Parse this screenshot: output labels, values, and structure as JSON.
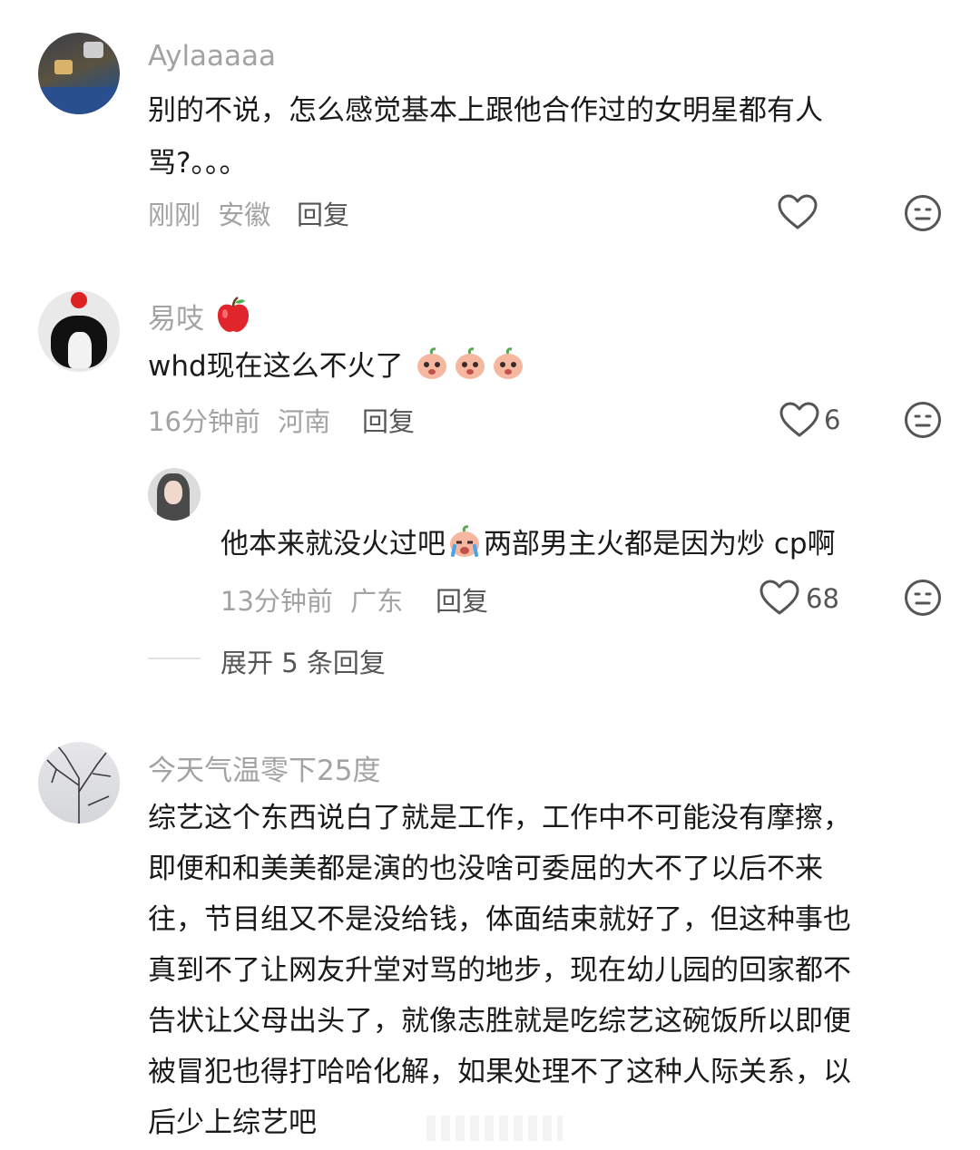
{
  "comments": [
    {
      "user": "Aylaaaaa",
      "text_line1": "别的不说，怎么感觉基本上跟他合作过的女明星都有人",
      "text_line2": "骂?。。。",
      "time": "刚刚",
      "location": "安徽",
      "reply_label": "回复",
      "like_count": ""
    },
    {
      "user": "易吱",
      "user_emoji": "red-apple-icon",
      "text": "whd现在这么不火了",
      "time": "16分钟前",
      "location": "河南",
      "reply_label": "回复",
      "like_count": "6",
      "sub_reply": {
        "text_before": "他本来就没火过吧",
        "text_after": "两部男主火都是因为炒 cp啊",
        "time": "13分钟前",
        "location": "广东",
        "reply_label": "回复",
        "like_count": "68"
      },
      "expand_label": "展开 5 条回复"
    },
    {
      "user": "今天气温零下25度",
      "lines": [
        "综艺这个东西说白了就是工作，工作中不可能没有摩擦，",
        "即便和和美美都是演的也没啥可委屈的大不了以后不来",
        "往，节目组又不是没给钱，体面结束就好了，但这种事也",
        "真到不了让网友升堂对骂的地步，现在幼儿园的回家都不",
        "告状让父母出头了，就像志胜就是吃综艺这碗饭所以即便",
        "被冒犯也得打哈哈化解，如果处理不了这种人际关系，以",
        "后少上综艺吧"
      ]
    }
  ],
  "colors": {
    "muted": "#a3a3a3",
    "text": "#1a1a1a",
    "icon": "#555555"
  }
}
